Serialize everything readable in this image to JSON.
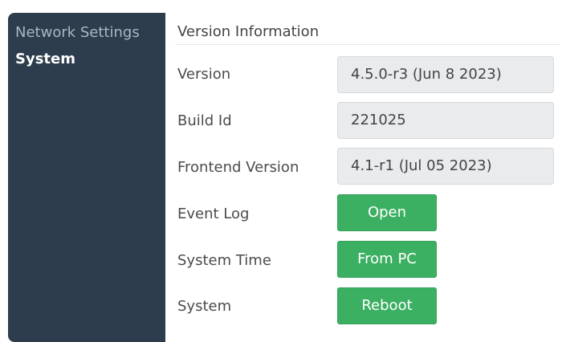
{
  "sidebar": {
    "items": [
      {
        "label": "Network Settings",
        "active": false
      },
      {
        "label": "System",
        "active": true
      }
    ]
  },
  "section": {
    "title": "Version Information"
  },
  "rows": {
    "version": {
      "label": "Version",
      "value": "4.5.0-r3 (Jun  8 2023)"
    },
    "build_id": {
      "label": "Build Id",
      "value": "221025"
    },
    "frontend_version": {
      "label": "Frontend Version",
      "value": "4.1-r1 (Jul 05 2023)"
    },
    "event_log": {
      "label": "Event Log",
      "button": "Open"
    },
    "system_time": {
      "label": "System Time",
      "button": "From PC"
    },
    "system": {
      "label": "System",
      "button": "Reboot"
    }
  },
  "colors": {
    "sidebar_bg": "#2e3d4d",
    "button_green": "#3cb062",
    "value_box_bg": "#e9ebed"
  }
}
